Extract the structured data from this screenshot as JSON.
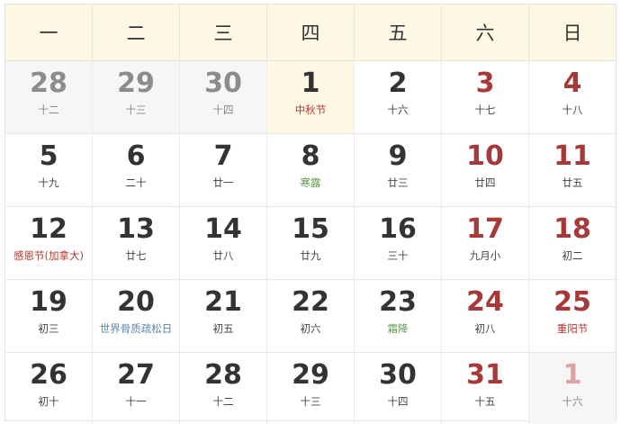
{
  "weekdays": [
    "一",
    "二",
    "三",
    "四",
    "五",
    "六",
    "日"
  ],
  "weeks": [
    [
      {
        "day": "28",
        "sub": "十二",
        "other": true
      },
      {
        "day": "29",
        "sub": "十三",
        "other": true
      },
      {
        "day": "30",
        "sub": "十四",
        "other": true
      },
      {
        "day": "1",
        "sub": "中秋节",
        "type": "festival",
        "today": true
      },
      {
        "day": "2",
        "sub": "十六"
      },
      {
        "day": "3",
        "sub": "十七",
        "weekend": true
      },
      {
        "day": "4",
        "sub": "十八",
        "weekend": true
      }
    ],
    [
      {
        "day": "5",
        "sub": "十九"
      },
      {
        "day": "6",
        "sub": "二十"
      },
      {
        "day": "7",
        "sub": "廿一"
      },
      {
        "day": "8",
        "sub": "寒露",
        "type": "term"
      },
      {
        "day": "9",
        "sub": "廿三"
      },
      {
        "day": "10",
        "sub": "廿四",
        "weekend": true
      },
      {
        "day": "11",
        "sub": "廿五",
        "weekend": true
      }
    ],
    [
      {
        "day": "12",
        "sub": "感恩节(加拿大)",
        "type": "holiday"
      },
      {
        "day": "13",
        "sub": "廿七"
      },
      {
        "day": "14",
        "sub": "廿八"
      },
      {
        "day": "15",
        "sub": "廿九"
      },
      {
        "day": "16",
        "sub": "三十"
      },
      {
        "day": "17",
        "sub": "九月小",
        "weekend": true
      },
      {
        "day": "18",
        "sub": "初二",
        "weekend": true
      }
    ],
    [
      {
        "day": "19",
        "sub": "初三"
      },
      {
        "day": "20",
        "sub": "世界骨质疏松日",
        "type": "intl"
      },
      {
        "day": "21",
        "sub": "初五"
      },
      {
        "day": "22",
        "sub": "初六"
      },
      {
        "day": "23",
        "sub": "霜降",
        "type": "term"
      },
      {
        "day": "24",
        "sub": "初八",
        "weekend": true
      },
      {
        "day": "25",
        "sub": "重阳节",
        "type": "festival",
        "weekend": true
      }
    ],
    [
      {
        "day": "26",
        "sub": "初十"
      },
      {
        "day": "27",
        "sub": "十一"
      },
      {
        "day": "28",
        "sub": "十二"
      },
      {
        "day": "29",
        "sub": "十三"
      },
      {
        "day": "30",
        "sub": "十四"
      },
      {
        "day": "31",
        "sub": "十五",
        "weekend": true
      },
      {
        "day": "1",
        "sub": "十六",
        "other": true,
        "weekend": true
      }
    ]
  ],
  "colors": {
    "header_bg": "#fdf8e4",
    "today_bg": "#fdf8e4",
    "other_month_bg": "#f6f6f6",
    "weekend": "#a63a3a",
    "festival": "#b0382f",
    "solar_term": "#5c9a4a",
    "intl_day": "#5f84a8"
  }
}
